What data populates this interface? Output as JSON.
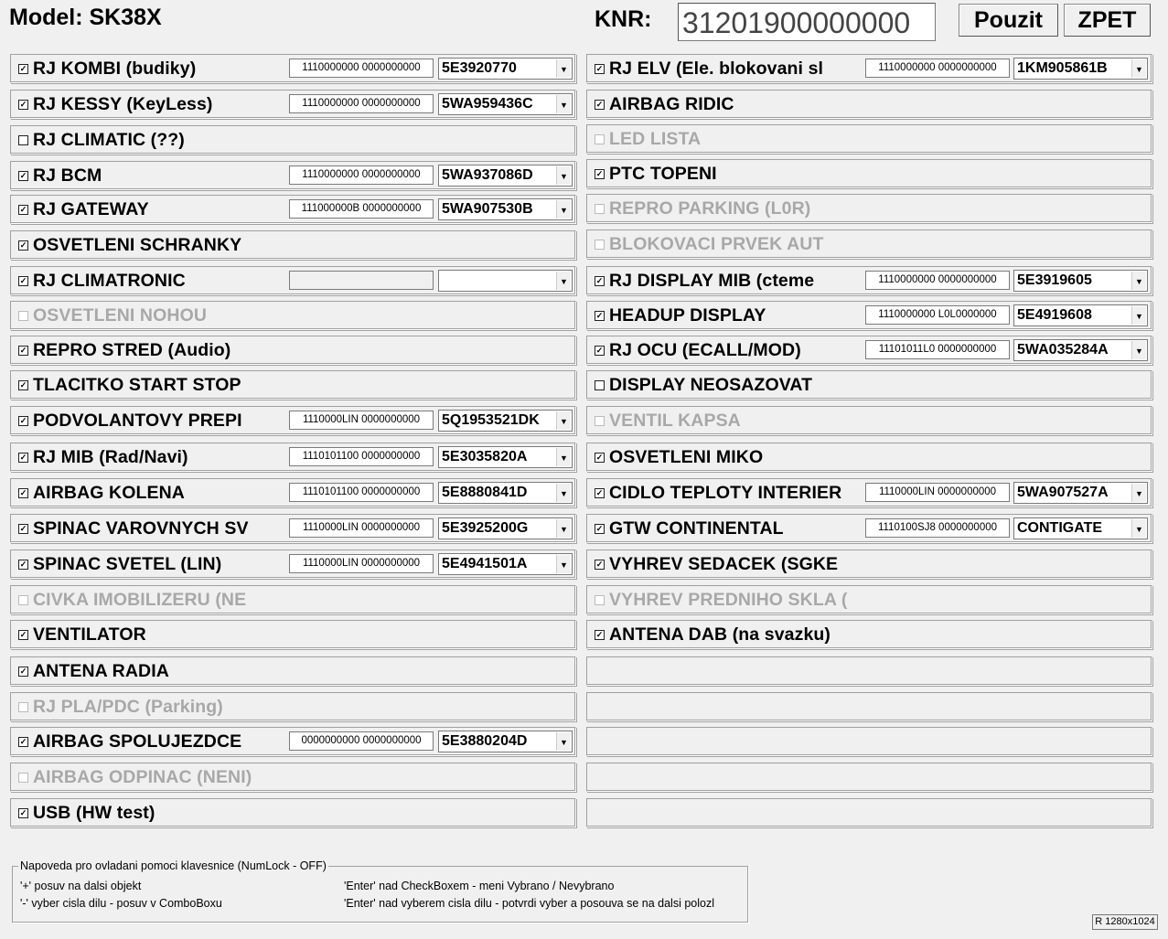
{
  "header": {
    "model_title": "Model: SK38X",
    "knr_label": "KNR:",
    "knr_value": "31201900000000",
    "use_button": "Pouzit",
    "back_button": "ZPET"
  },
  "left_rows": [
    {
      "checked": true,
      "enabled": true,
      "label": "RJ KOMBI (budiky)",
      "code": "1110000000 0000000000",
      "part": "5E3920770"
    },
    {
      "checked": true,
      "enabled": true,
      "label": "RJ KESSY (KeyLess)",
      "code": "1110000000 0000000000",
      "part": "5WA959436C"
    },
    {
      "checked": false,
      "enabled": true,
      "label": "RJ CLIMATIC (??)"
    },
    {
      "checked": true,
      "enabled": true,
      "label": "RJ BCM",
      "code": "1110000000 0000000000",
      "part": "5WA937086D"
    },
    {
      "checked": true,
      "enabled": true,
      "label": "RJ GATEWAY",
      "code": "111000000B 0000000000",
      "part": "5WA907530B"
    },
    {
      "checked": true,
      "enabled": true,
      "label": "OSVETLENI SCHRANKY"
    },
    {
      "checked": true,
      "enabled": true,
      "label": "RJ CLIMATRONIC",
      "code": "",
      "part": ""
    },
    {
      "checked": false,
      "enabled": false,
      "label": "OSVETLENI NOHOU"
    },
    {
      "checked": true,
      "enabled": true,
      "label": "REPRO STRED (Audio)"
    },
    {
      "checked": true,
      "enabled": true,
      "label": "TLACITKO START STOP"
    },
    {
      "checked": true,
      "enabled": true,
      "label": "PODVOLANTOVY PREPI",
      "code": "1110000LIN 0000000000",
      "part": "5Q1953521DK"
    },
    {
      "checked": true,
      "enabled": true,
      "label": "RJ MIB (Rad/Navi)",
      "code": "1110101100 0000000000",
      "part": "5E3035820A"
    },
    {
      "checked": true,
      "enabled": true,
      "label": "AIRBAG KOLENA",
      "code": "1110101100 0000000000",
      "part": "5E8880841D"
    },
    {
      "checked": true,
      "enabled": true,
      "label": "SPINAC  VAROVNYCH SV",
      "code": "1110000LIN 0000000000",
      "part": "5E3925200G"
    },
    {
      "checked": true,
      "enabled": true,
      "label": "SPINAC SVETEL (LIN)",
      "code": "1110000LIN 0000000000",
      "part": "5E4941501A"
    },
    {
      "checked": false,
      "enabled": false,
      "label": "CIVKA  IMOBILIZERU (NE"
    },
    {
      "checked": true,
      "enabled": true,
      "label": "VENTILATOR"
    },
    {
      "checked": true,
      "enabled": true,
      "label": "ANTENA RADIA"
    },
    {
      "checked": false,
      "enabled": false,
      "label": "RJ PLA/PDC (Parking)"
    },
    {
      "checked": true,
      "enabled": true,
      "label": "AIRBAG SPOLUJEZDCE",
      "code": "0000000000 0000000000",
      "part": "5E3880204D"
    },
    {
      "checked": false,
      "enabled": false,
      "label": "AIRBAG ODPINAC (NENI)"
    },
    {
      "checked": true,
      "enabled": true,
      "label": "USB (HW test)"
    }
  ],
  "right_rows": [
    {
      "checked": true,
      "enabled": true,
      "label": "RJ ELV (Ele. blokovani sl",
      "code": "1110000000 0000000000",
      "part": "1KM905861B"
    },
    {
      "checked": true,
      "enabled": true,
      "label": "AIRBAG RIDIC"
    },
    {
      "checked": false,
      "enabled": false,
      "label": "LED LISTA"
    },
    {
      "checked": true,
      "enabled": true,
      "label": "PTC TOPENI"
    },
    {
      "checked": false,
      "enabled": false,
      "label": "REPRO PARKING (L0R)"
    },
    {
      "checked": false,
      "enabled": false,
      "label": "BLOKOVACI  PRVEK AUT"
    },
    {
      "checked": true,
      "enabled": true,
      "label": "RJ DISPLAY MIB (cteme",
      "code": "1110000000 0000000000",
      "part": "5E3919605"
    },
    {
      "checked": true,
      "enabled": true,
      "label": "HEADUP DISPLAY",
      "code": "1110000000 L0L0000000",
      "part": "5E4919608"
    },
    {
      "checked": true,
      "enabled": true,
      "label": "RJ OCU (ECALL/MOD)",
      "code": "11101011L0 0000000000",
      "part": "5WA035284A"
    },
    {
      "checked": false,
      "enabled": true,
      "label": "DISPLAY NEOSAZOVAT"
    },
    {
      "checked": false,
      "enabled": false,
      "label": "VENTIL KAPSA"
    },
    {
      "checked": true,
      "enabled": true,
      "label": "OSVETLENI MIKO"
    },
    {
      "checked": true,
      "enabled": true,
      "label": "CIDLO TEPLOTY INTERIER",
      "code": "1110000LIN 0000000000",
      "part": "5WA907527A"
    },
    {
      "checked": true,
      "enabled": true,
      "label": "GTW CONTINENTAL",
      "code": "1110100SJ8 0000000000",
      "part": "CONTIGATE"
    },
    {
      "checked": true,
      "enabled": true,
      "label": "VYHREV SEDACEK (SGKE"
    },
    {
      "checked": false,
      "enabled": false,
      "label": "VYHREV PREDNIHO SKLA ("
    },
    {
      "checked": true,
      "enabled": true,
      "label": "ANTENA DAB (na svazku)"
    },
    {
      "empty": true
    },
    {
      "empty": true
    },
    {
      "empty": true
    },
    {
      "empty": true
    },
    {
      "empty": true
    }
  ],
  "help": {
    "title": "Napoveda pro ovladani pomoci klavesnice (NumLock - OFF)",
    "line1_left": "'+' posuv na dalsi objekt",
    "line1_right": "'Enter' nad CheckBoxem - meni  Vybrano / Nevybrano",
    "line2_left": "'-' vyber cisla dilu - posuv v ComboBoxu",
    "line2_right": "'Enter' nad vyberem cisla dilu - potvrdi vyber a posouva se  na dalsi polozl"
  },
  "resolution": "R 1280x1024"
}
